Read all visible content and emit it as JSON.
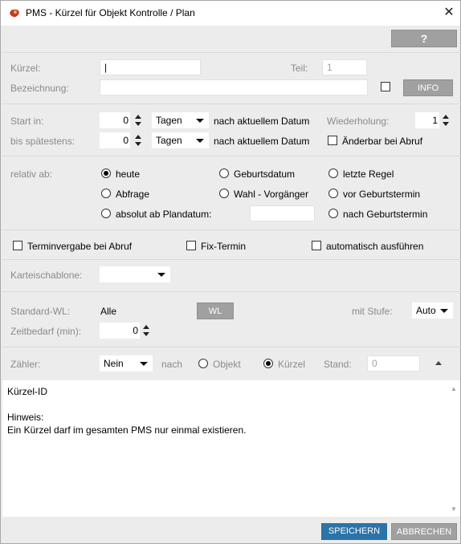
{
  "window": {
    "title": "PMS - Kürzel für Objekt Kontrolle / Plan",
    "close_glyph": "✕"
  },
  "help_button": "?",
  "kuerzel": {
    "label": "Kürzel:",
    "value": "|",
    "teil_label": "Teil:",
    "teil_value": "1"
  },
  "bezeichnung": {
    "label": "Bezeichnung:",
    "value": "",
    "info_button": "INFO"
  },
  "start": {
    "label": "Start in:",
    "value": "0",
    "unit": "Tagen",
    "suffix": "nach aktuellem Datum",
    "wiederholung_label": "Wiederholung:",
    "wiederholung_value": "1"
  },
  "spaetestens": {
    "label": "bis spätestens:",
    "value": "0",
    "unit": "Tagen",
    "suffix": "nach aktuellem Datum",
    "aenderbar_label": "Änderbar bei Abruf"
  },
  "relativ": {
    "label": "relativ ab:",
    "options": {
      "heute": "heute",
      "geburtsdatum": "Geburtsdatum",
      "letzte_regel": "letzte Regel",
      "abfrage": "Abfrage",
      "wahl_vorgaenger": "Wahl - Vorgänger",
      "vor_geburtstermin": "vor Geburtstermin",
      "absolut": "absolut ab Plandatum:",
      "nach_geburtstermin": "nach Geburtstermin"
    },
    "selected": "heute"
  },
  "checks": {
    "terminvergabe": "Terminvergabe bei Abruf",
    "fix_termin": "Fix-Termin",
    "automatisch": "automatisch ausführen"
  },
  "karteischablone": {
    "label": "Karteischablone:",
    "value": ""
  },
  "standard_wl": {
    "label": "Standard-WL:",
    "value": "Alle",
    "wl_button": "WL",
    "stufe_label": "mit Stufe:",
    "stufe_value": "Auto"
  },
  "zeitbedarf": {
    "label": "Zeitbedarf (min):",
    "value": "0"
  },
  "zaehler": {
    "label": "Zähler:",
    "value": "Nein",
    "nach_label": "nach",
    "objekt_label": "Objekt",
    "kuerzel_label": "Kürzel",
    "selected": "Kürzel",
    "stand_label": "Stand:",
    "stand_value": "0"
  },
  "notes": {
    "text": "Kürzel-ID\n\nHinweis:\nEin Kürzel darf im gesamten PMS nur einmal existieren."
  },
  "footer": {
    "save": "SPEICHERN",
    "cancel": "ABBRECHEN"
  },
  "colors": {
    "accent": "#2b73a8",
    "button_gray": "#a0a0a0",
    "background": "#ececec"
  }
}
